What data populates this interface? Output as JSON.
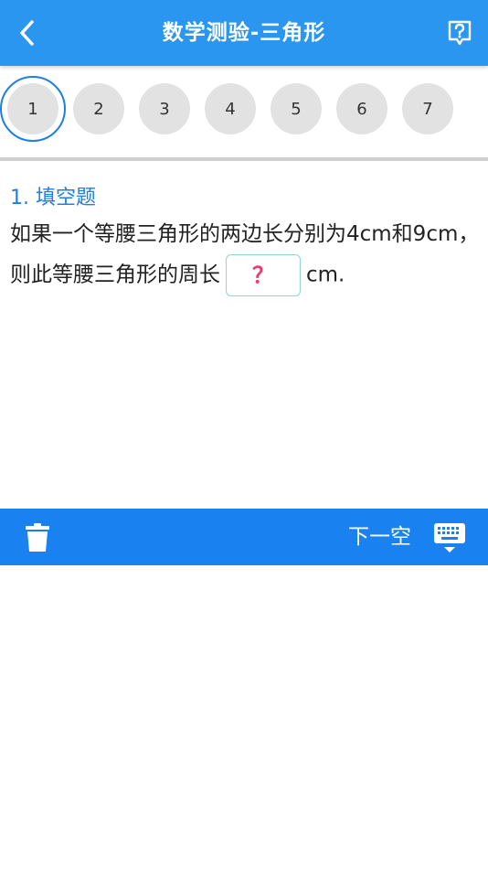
{
  "header": {
    "title": "数学测验-三角形"
  },
  "questions": {
    "numbers": [
      "1",
      "2",
      "3",
      "4",
      "5",
      "6",
      "7"
    ]
  },
  "question": {
    "title": "1. 填空题",
    "text_before": "如果一个等腰三角形的两边长分别为4cm和9cm，则此等腰三角形的周长",
    "blank": "？",
    "text_after": "cm."
  },
  "toolbar": {
    "next_label": "下一空"
  },
  "icons": {
    "back": "back-arrow-icon",
    "help": "help-icon",
    "trash": "trash-icon",
    "keyboard": "keyboard-icon"
  },
  "colors": {
    "header": "#2b96f0",
    "toolbar": "#1a82f0",
    "accent": "#1e7fe3",
    "blank_mark": "#ee3b6b"
  }
}
